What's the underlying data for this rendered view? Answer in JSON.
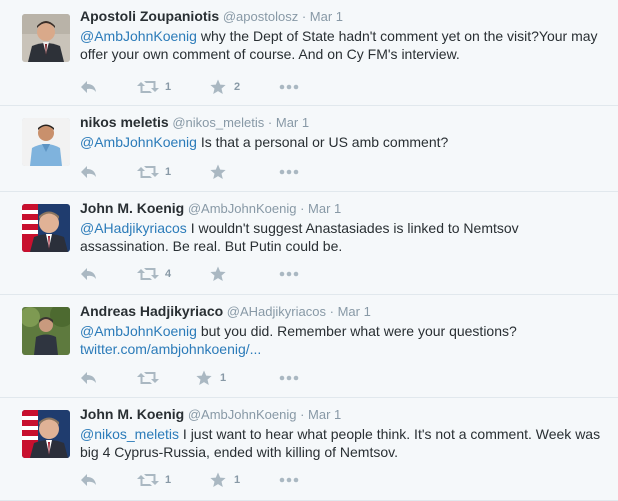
{
  "tweets": [
    {
      "name": "Apostoli Zoupaniotis",
      "handle": "@apostolosz",
      "time": "Mar 1",
      "mention": "@AmbJohnKoenig",
      "text": " why the Dept of State hadn't comment yet on the visit?Your may offer your own comment of course. And on Cy FM's interview.",
      "retweets": "1",
      "favorites": "2",
      "avatar": "suit-man"
    },
    {
      "name": "nikos meletis",
      "handle": "@nikos_meletis",
      "time": "Mar 1",
      "mention": "@AmbJohnKoenig",
      "text": "  Is that a personal  or US amb comment?",
      "retweets": "1",
      "favorites": "",
      "avatar": "blue-shirt-man"
    },
    {
      "name": "John M. Koenig",
      "handle": "@AmbJohnKoenig",
      "time": "Mar 1",
      "mention": "@AHadjikyriacos",
      "text": " I wouldn't suggest Anastasiades is linked to Nemtsov assassination. Be real.  But Putin could be.",
      "retweets": "4",
      "favorites": "",
      "avatar": "flag-man"
    },
    {
      "name": "Andreas Hadjikyriaco",
      "handle": "@AHadjikyriacos",
      "time": "Mar 1",
      "mention": "@AmbJohnKoenig",
      "text": " but you did. Remember what were your questions?",
      "link": "twitter.com/ambjohnkoenig/...",
      "retweets": "",
      "favorites": "1",
      "avatar": "outdoor-man"
    },
    {
      "name": "John M. Koenig",
      "handle": "@AmbJohnKoenig",
      "time": "Mar 1",
      "mention": "@nikos_meletis",
      "text": " I just want to hear what people think. It's not a comment. Week was big 4 Cyprus-Russia, ended with killing of Nemtsov.",
      "retweets": "1",
      "favorites": "1",
      "avatar": "flag-man"
    }
  ],
  "separator": "·",
  "colors": {
    "link": "#2b7bb9",
    "muted": "#8899a6",
    "icon": "#aab8c2",
    "border": "#e1e8ed",
    "background": "#f5f8fa"
  },
  "icons": {
    "reply": "reply-icon",
    "retweet": "retweet-icon",
    "favorite": "favorite-star-icon",
    "more": "more-dots-icon"
  }
}
